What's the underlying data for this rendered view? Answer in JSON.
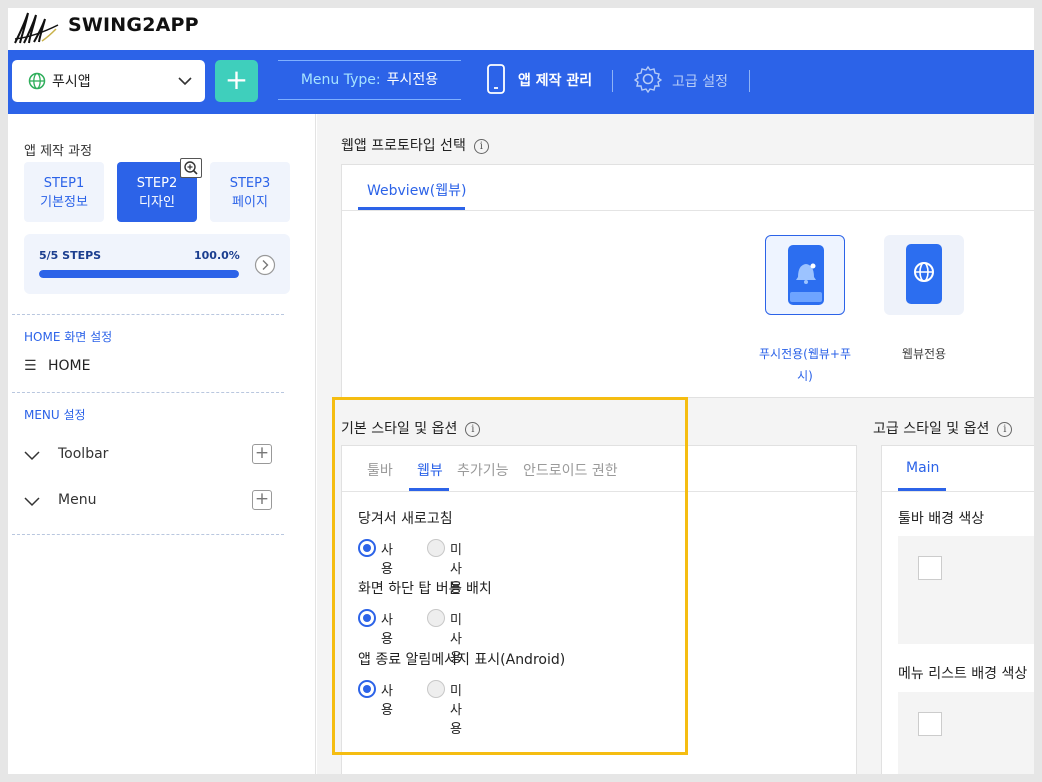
{
  "brand": {
    "name": "SWING2APP"
  },
  "topnav": {
    "app_select": "푸시앱",
    "add_button": "+",
    "menu_type_label": "Menu Type:",
    "menu_type_value": "푸시전용",
    "app_manage": "앱 제작 관리",
    "advanced": "고급 설정"
  },
  "sidebar": {
    "process_title": "앱 제작 과정",
    "steps": [
      {
        "line1": "STEP1",
        "line2": "기본정보",
        "active": false
      },
      {
        "line1": "STEP2",
        "line2": "디자인",
        "active": true
      },
      {
        "line1": "STEP3",
        "line2": "페이지",
        "active": false
      }
    ],
    "progress": {
      "steps_text": "5/5 STEPS",
      "percent_text": "100.0%",
      "fraction": 1.0
    },
    "home_section": "HOME 화면 설정",
    "home_item": "HOME",
    "menu_section": "MENU 설정",
    "menu_items": [
      "Toolbar",
      "Menu"
    ]
  },
  "prototype": {
    "title": "웹앱 프로토타입 선택",
    "tab": "Webview(웹뷰)",
    "cards": [
      {
        "line1": "푸시전용(웹뷰+푸",
        "line2": "시)",
        "selected": true,
        "icon": "bell-phone-icon"
      },
      {
        "line1": "웹뷰전용",
        "line2": "",
        "selected": false,
        "icon": "globe-phone-icon"
      }
    ]
  },
  "basic_options": {
    "title": "기본 스타일 및 옵션",
    "tabs": [
      "툴바",
      "웹뷰",
      "추가기능",
      "안드로이드 권한"
    ],
    "active_tab": 1,
    "options": [
      {
        "label": "당겨서 새로고침",
        "on_label": "사용",
        "off_label": "미사용",
        "selected": "on"
      },
      {
        "label": "화면 하단 탑 버튼 배치",
        "on_label": "사용",
        "off_label": "미사용",
        "selected": "on"
      },
      {
        "label": "앱 종료 알림메시지 표시(Android)",
        "on_label": "사용",
        "off_label": "미사용",
        "selected": "on"
      }
    ]
  },
  "advanced_options": {
    "title": "고급 스타일 및 옵션",
    "tab": "Main",
    "fields": [
      "툴바 배경 색상",
      "메뉴 리스트 배경 색상"
    ]
  },
  "colors": {
    "primary": "#2c63e8",
    "accent": "#3fcfbc",
    "highlight": "#f5bd11"
  }
}
